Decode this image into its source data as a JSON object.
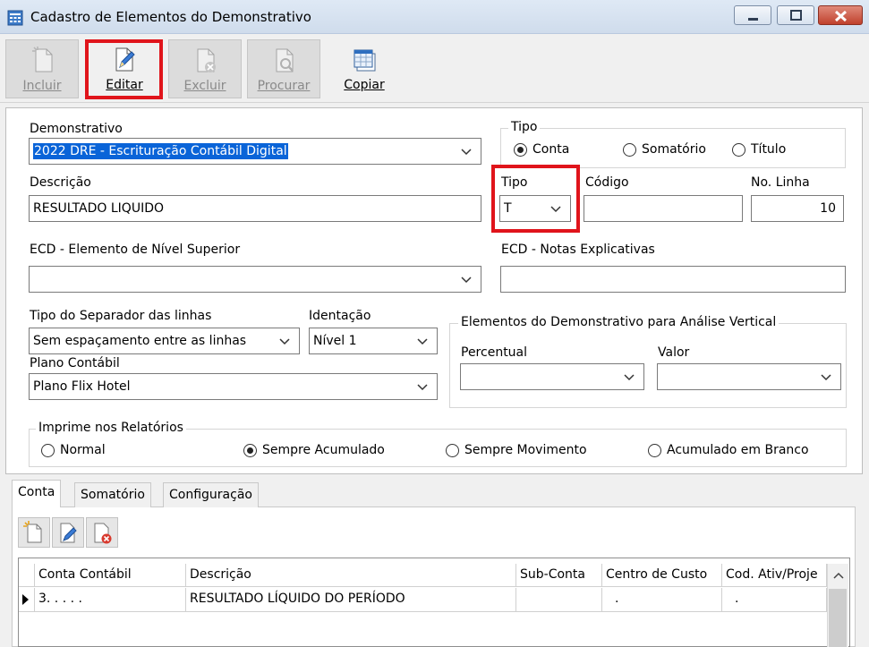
{
  "window": {
    "title": "Cadastro de Elementos do Demonstrativo"
  },
  "toolbar": {
    "incluir": "Incluir",
    "editar": "Editar",
    "excluir": "Excluir",
    "procurar": "Procurar",
    "copiar": "Copiar"
  },
  "form": {
    "demonstrativo_label": "Demonstrativo",
    "demonstrativo_value": "2022 DRE - Escrituração Contábil Digital",
    "tipo_group_label": "Tipo",
    "tipo_options": [
      "Conta",
      "Somatório",
      "Título"
    ],
    "tipo_selected": "Conta",
    "descricao_label": "Descrição",
    "descricao_value": "RESULTADO LIQUIDO",
    "tipo2_label": "Tipo",
    "tipo2_value": "T",
    "codigo_label": "Código",
    "codigo_value": "",
    "no_linha_label": "No. Linha",
    "no_linha_value": "10",
    "ecd_superior_label": "ECD - Elemento de Nível Superior",
    "ecd_superior_value": "",
    "ecd_notas_label": "ECD - Notas Explicativas",
    "ecd_notas_value": "",
    "separador_label": "Tipo do Separador das linhas",
    "separador_value": "Sem espaçamento entre as linhas",
    "identacao_label": "Identação",
    "identacao_value": "Nível 1",
    "plano_label": "Plano Contábil",
    "plano_value": "Plano Flix Hotel",
    "analise_group_label": "Elementos do Demonstrativo para Análise Vertical",
    "percentual_label": "Percentual",
    "percentual_value": "",
    "valor_label": "Valor",
    "valor_value": "",
    "imprime_group_label": "Imprime nos Relatórios",
    "imprime_options": [
      "Normal",
      "Sempre Acumulado",
      "Sempre Movimento",
      "Acumulado em Branco"
    ],
    "imprime_selected": "Sempre Acumulado"
  },
  "tabs": [
    "Conta",
    "Somatório",
    "Configuração"
  ],
  "active_tab": "Conta",
  "grid": {
    "columns": [
      "Conta Contábil",
      "Descrição",
      "Sub-Conta",
      "Centro de Custo",
      "Cod. Ativ/Proje"
    ],
    "rows": [
      {
        "conta": "3. . . . .",
        "descricao": "RESULTADO LÍQUIDO DO PERÍODO",
        "sub_conta": "",
        "centro_custo": ".",
        "cod_ativ": "."
      }
    ]
  },
  "colors": {
    "highlight": "#e0141b",
    "selection": "#0a64d8"
  }
}
